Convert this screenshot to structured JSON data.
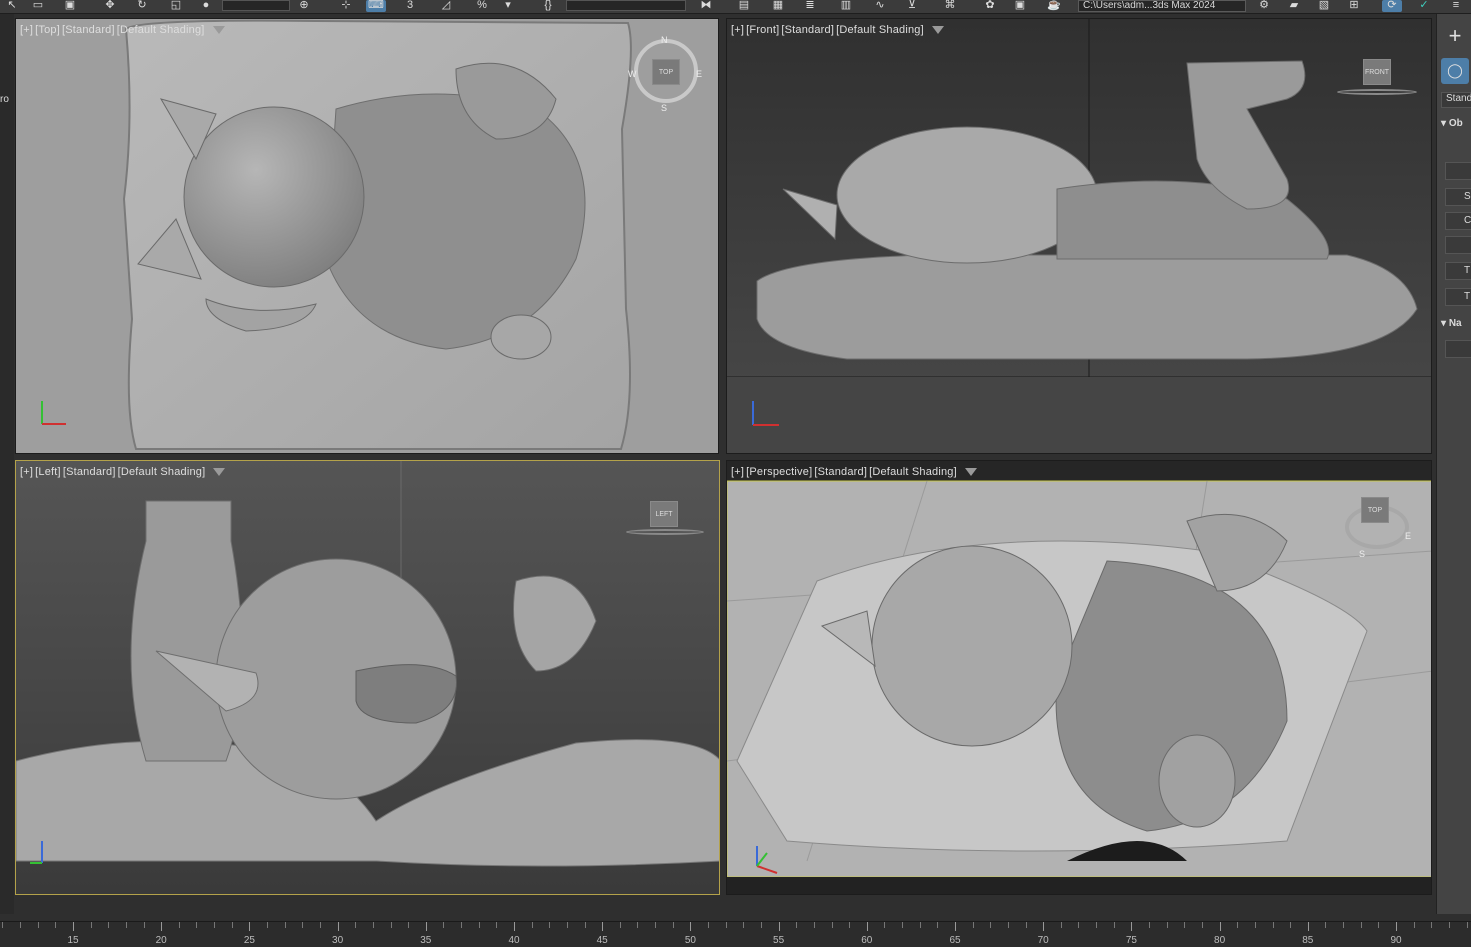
{
  "toolbar": {
    "path_text": "C:\\Users\\adm...3ds Max 2024",
    "icons": [
      "select-arrow-icon",
      "select-region-icon",
      "window-crossing-icon",
      "move-icon",
      "rotate-icon",
      "scale-icon",
      "selection-filter-icon",
      "snap-icon",
      "angle-snap-icon",
      "percent-snap-icon",
      "spinner-snap-icon",
      "named-selection-icon",
      "mirror-icon",
      "align-icon",
      "layers-icon",
      "scene-explorer-icon",
      "curve-editor-icon",
      "schematic-icon",
      "material-editor-icon",
      "render-setup-icon",
      "render-icon",
      "project-folder-icon"
    ]
  },
  "left_strip": {
    "label": "ro"
  },
  "viewports": {
    "top": {
      "label_parts": [
        "[+]",
        "[Top]",
        "[Standard]",
        "[Default Shading]"
      ],
      "cube": "TOP",
      "compass": [
        "N",
        "E",
        "S",
        "W"
      ]
    },
    "front": {
      "label_parts": [
        "[+]",
        "[Front]",
        "[Standard]",
        "[Default Shading]"
      ],
      "cube": "FRONT"
    },
    "left": {
      "label_parts": [
        "[+]",
        "[Left]",
        "[Standard]",
        "[Default Shading]"
      ],
      "cube": "LEFT"
    },
    "perspective": {
      "label_parts": [
        "[+]",
        "[Perspective]",
        "[Standard]",
        "[Default Shading]"
      ],
      "cube": "TOP",
      "compass": [
        "S",
        "E"
      ]
    }
  },
  "command_panel": {
    "create_glyph": "+",
    "dropdown": "Stand",
    "rollouts": [
      "Ob",
      "Na"
    ],
    "buttons": [
      "S",
      "C",
      "T",
      "T"
    ]
  },
  "timeline": {
    "labels": [
      "15",
      "20",
      "25",
      "30",
      "35",
      "40",
      "45",
      "50",
      "55",
      "60",
      "65",
      "70",
      "75",
      "80",
      "85",
      "90"
    ]
  }
}
